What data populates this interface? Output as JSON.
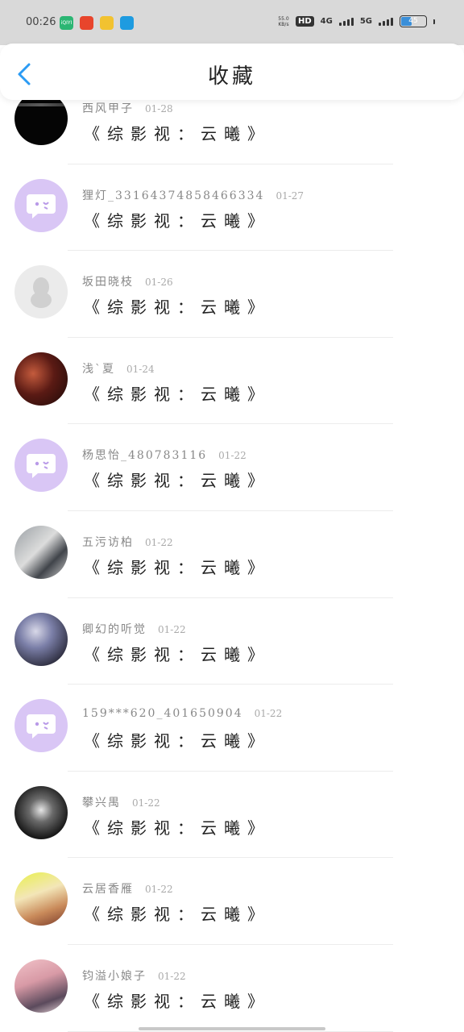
{
  "status_bar": {
    "time": "00:26",
    "speed": "55.0 KB/s",
    "hd": "HD",
    "net1": "4G",
    "net2": "5G",
    "battery": "45",
    "battery_level": 0.45,
    "apps": [
      {
        "icon": "iqiyi-app-icon",
        "color": "#2bb673",
        "label": "iQIYI"
      },
      {
        "icon": "red-app-icon",
        "color": "#e8452c",
        "label": ""
      },
      {
        "icon": "yellow-app-icon",
        "color": "#f2c230",
        "label": ""
      },
      {
        "icon": "qq-app-icon",
        "color": "#1e9be0",
        "label": ""
      }
    ]
  },
  "header": {
    "title": "收藏",
    "back_icon": "chevron-left-icon",
    "accent_color": "#2b9bf4"
  },
  "items": [
    {
      "name": "西风甲子",
      "date": "01-28",
      "content": "《综影视：云曦》",
      "avatar": "black"
    },
    {
      "name": "狸灯_33164374858466334",
      "date": "01-27",
      "content": "《综影视：云曦》",
      "avatar": "purple-chat"
    },
    {
      "name": "坂田晓枝",
      "date": "01-26",
      "content": "《综影视：云曦》",
      "avatar": "grey-default"
    },
    {
      "name": "浅`夏",
      "date": "01-24",
      "content": "《综影视：云曦》",
      "avatar": "photo-dark-red"
    },
    {
      "name": "杨思怡_480783116",
      "date": "01-22",
      "content": "《综影视：云曦》",
      "avatar": "purple-chat"
    },
    {
      "name": "五污访柏",
      "date": "01-22",
      "content": "《综影视：云曦》",
      "avatar": "photo-grey"
    },
    {
      "name": "卿幻的听觉",
      "date": "01-22",
      "content": "《综影视：云曦》",
      "avatar": "photo-anime"
    },
    {
      "name": "159***620_401650904",
      "date": "01-22",
      "content": "《综影视：云曦》",
      "avatar": "purple-chat"
    },
    {
      "name": "攀兴禺",
      "date": "01-22",
      "content": "《综影视：云曦》",
      "avatar": "photo-bw"
    },
    {
      "name": "云居香雁",
      "date": "01-22",
      "content": "《综影视：云曦》",
      "avatar": "photo-yellow"
    },
    {
      "name": "钧溢小娘子",
      "date": "01-22",
      "content": "《综影视：云曦》",
      "avatar": "photo-pink"
    }
  ]
}
